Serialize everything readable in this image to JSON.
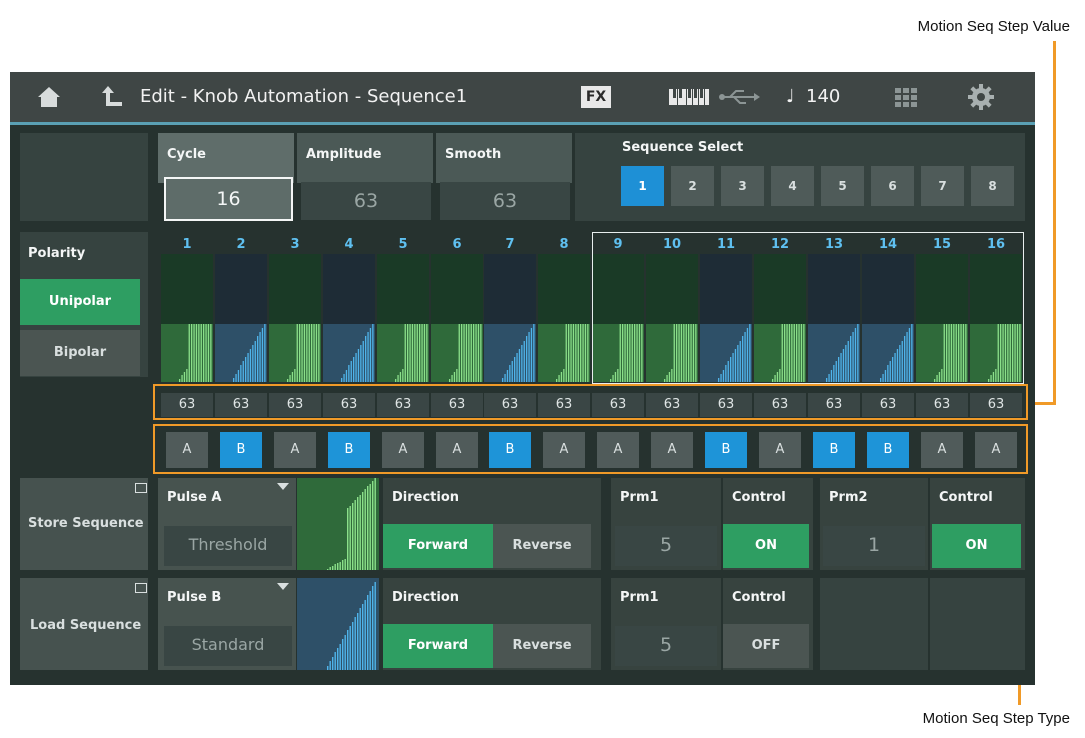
{
  "annotations": {
    "step_value_label": "Motion Seq Step Value",
    "step_type_label": "Motion Seq Step Type",
    "line_color": "#f09a28"
  },
  "titlebar": {
    "home_icon": "home-icon",
    "back_icon": "return-arrow-icon",
    "title": "Edit - Knob Automation - Sequence1",
    "fx_label": "FX",
    "keyboard_icon": "keyboard-icon",
    "usb_icon": "usb-icon",
    "tempo_icon": "quarter-note-icon",
    "tempo_note": "♩",
    "tempo": "140",
    "grid_icon": "quick-access-icon",
    "settings_icon": "gear-icon"
  },
  "params": {
    "cycle_label": "Cycle",
    "cycle_value": "16",
    "amplitude_label": "Amplitude",
    "amplitude_value": "63",
    "smooth_label": "Smooth",
    "smooth_value": "63"
  },
  "sequence_select": {
    "label": "Sequence Select",
    "options": [
      "1",
      "2",
      "3",
      "4",
      "5",
      "6",
      "7",
      "8"
    ],
    "selected_index": 0
  },
  "polarity": {
    "label": "Polarity",
    "options": [
      "Unipolar",
      "Bipolar"
    ],
    "selected": "Unipolar"
  },
  "steps": [
    {
      "number": "1",
      "value": "63",
      "type": "A"
    },
    {
      "number": "2",
      "value": "63",
      "type": "B"
    },
    {
      "number": "3",
      "value": "63",
      "type": "A"
    },
    {
      "number": "4",
      "value": "63",
      "type": "B"
    },
    {
      "number": "5",
      "value": "63",
      "type": "A"
    },
    {
      "number": "6",
      "value": "63",
      "type": "A"
    },
    {
      "number": "7",
      "value": "63",
      "type": "B"
    },
    {
      "number": "8",
      "value": "63",
      "type": "A"
    },
    {
      "number": "9",
      "value": "63",
      "type": "A"
    },
    {
      "number": "10",
      "value": "63",
      "type": "A"
    },
    {
      "number": "11",
      "value": "63",
      "type": "B"
    },
    {
      "number": "12",
      "value": "63",
      "type": "A"
    },
    {
      "number": "13",
      "value": "63",
      "type": "B"
    },
    {
      "number": "14",
      "value": "63",
      "type": "B"
    },
    {
      "number": "15",
      "value": "63",
      "type": "A"
    },
    {
      "number": "16",
      "value": "63",
      "type": "A"
    }
  ],
  "pulse_a": {
    "store_label": "Store Sequence",
    "store_icon": "window-icon",
    "name": "Pulse A",
    "dropdown_icon": "dropdown-triangle-icon",
    "curve": "Threshold",
    "direction_label": "Direction",
    "forward": "Forward",
    "reverse": "Reverse",
    "direction_selected": "Forward",
    "prm1_label": "Prm1",
    "prm1_value": "5",
    "control1_label": "Control",
    "control1_value": "ON",
    "prm2_label": "Prm2",
    "prm2_value": "1",
    "control2_label": "Control",
    "control2_value": "ON"
  },
  "pulse_b": {
    "load_label": "Load Sequence",
    "load_icon": "window-icon",
    "name": "Pulse B",
    "dropdown_icon": "dropdown-triangle-icon",
    "curve": "Standard",
    "direction_label": "Direction",
    "forward": "Forward",
    "reverse": "Reverse",
    "direction_selected": "Forward",
    "prm1_label": "Prm1",
    "prm1_value": "5",
    "control1_label": "Control",
    "control1_value": "OFF"
  },
  "colors": {
    "accent_blue": "#1e90d6",
    "active_green": "#2e9e62",
    "type_a_fill": "#3ea856",
    "type_b_fill": "#1e94d8"
  }
}
